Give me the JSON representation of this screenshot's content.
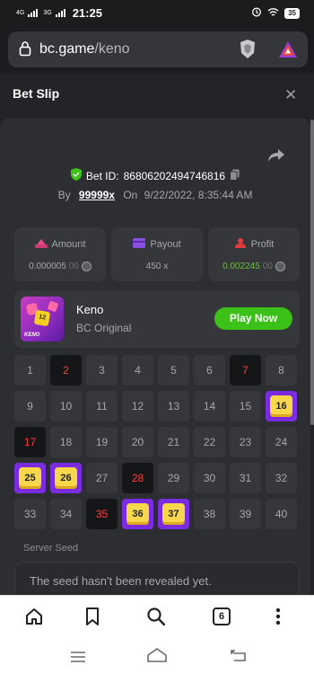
{
  "status_bar": {
    "network1": "4G",
    "network2": "3G",
    "time": "21:25",
    "battery": "35"
  },
  "browser": {
    "url_domain": "bc.game",
    "url_path": "/keno"
  },
  "slip": {
    "title": "Bet Slip",
    "bet_id_label": "Bet ID:",
    "bet_id": "86806202494746816",
    "by_label": "By",
    "user": "99999x",
    "on_label": "On",
    "datetime": "9/22/2022, 8:35:44 AM",
    "stats": [
      {
        "label": "Amount",
        "value": "0.000005",
        "value_dim": "00",
        "icon": "coins-icon"
      },
      {
        "label": "Payout",
        "value": "450 x",
        "value_dim": "",
        "icon": "wallet-icon"
      },
      {
        "label": "Profit",
        "value": "0.002245",
        "value_dim": "00",
        "icon": "profit-icon"
      }
    ],
    "game": {
      "name": "Keno",
      "sub": "BC Original",
      "thumb_label": "KENO",
      "dice_number": "12",
      "play_label": "Play Now"
    },
    "grid": {
      "numbers": [
        "1",
        "2",
        "3",
        "4",
        "5",
        "6",
        "7",
        "8",
        "9",
        "10",
        "11",
        "12",
        "13",
        "14",
        "15",
        "16",
        "17",
        "18",
        "19",
        "20",
        "21",
        "22",
        "23",
        "24",
        "25",
        "26",
        "27",
        "28",
        "29",
        "30",
        "31",
        "32",
        "33",
        "34",
        "35",
        "36",
        "37",
        "38",
        "39",
        "40"
      ],
      "drawn_misses": [
        2,
        7,
        17,
        28,
        35
      ],
      "hits": [
        16,
        25,
        26,
        36,
        37
      ]
    },
    "server_seed_label": "Server Seed",
    "server_seed_text": "The seed hasn't been revealed yet."
  },
  "bottom_nav": {
    "tab_count": "6"
  },
  "colors": {
    "accent_green": "#3bc117",
    "hit_purple": "#7b2ce0",
    "hit_yellow": "#f8d74a",
    "miss_red": "#ff3a3a"
  }
}
